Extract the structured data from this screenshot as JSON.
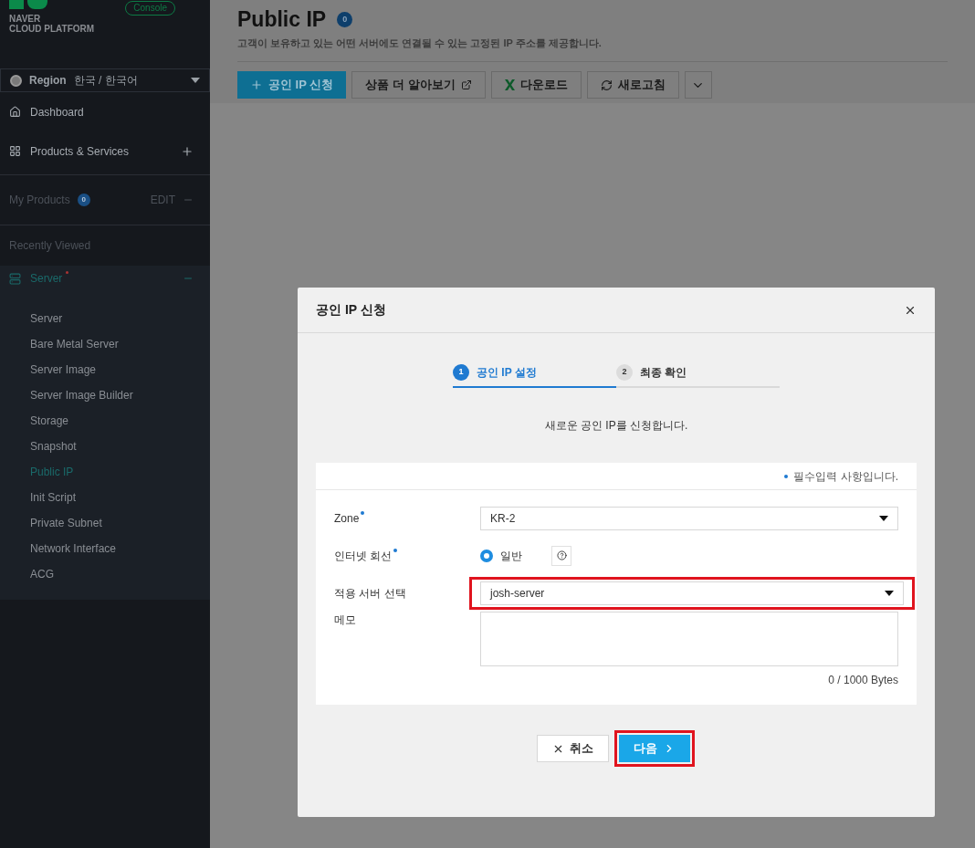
{
  "sidebar": {
    "logo": {
      "line1": "NAVER",
      "line2": "CLOUD PLATFORM"
    },
    "console_badge": "Console",
    "region": {
      "label": "Region",
      "value": "한국 / 한국어"
    },
    "nav": [
      {
        "kind": "dashboard",
        "label": "Dashboard"
      },
      {
        "kind": "products",
        "label": "Products & Services"
      }
    ],
    "my_products": {
      "label": "My Products",
      "count": "0",
      "edit": "EDIT"
    },
    "recently_viewed": "Recently Viewed",
    "section": {
      "label": "Server",
      "expanded": true,
      "items": [
        {
          "label": "Server",
          "selected": false
        },
        {
          "label": "Bare Metal Server",
          "selected": false
        },
        {
          "label": "Server Image",
          "selected": false
        },
        {
          "label": "Server Image Builder",
          "selected": false
        },
        {
          "label": "Storage",
          "selected": false
        },
        {
          "label": "Snapshot",
          "selected": false
        },
        {
          "label": "Public IP",
          "selected": true
        },
        {
          "label": "Init Script",
          "selected": false
        },
        {
          "label": "Private Subnet",
          "selected": false
        },
        {
          "label": "Network Interface",
          "selected": false
        },
        {
          "label": "ACG",
          "selected": false
        }
      ]
    }
  },
  "page": {
    "title": "Public IP",
    "count": "0",
    "description": "고객이 보유하고 있는 어떤 서버에도 연결될 수 있는 고정된 IP 주소를 제공합니다.",
    "toolbar": [
      {
        "kind": "primary",
        "label": "공인 IP 신청"
      },
      {
        "kind": "external",
        "label": "상품 더 알아보기"
      },
      {
        "kind": "excel",
        "label": "다운로드"
      },
      {
        "kind": "refresh",
        "label": "새로고침"
      },
      {
        "kind": "more"
      }
    ]
  },
  "modal": {
    "title": "공인 IP 신청",
    "steps": [
      {
        "number": "1",
        "label": "공인 IP 설정",
        "selected": true
      },
      {
        "number": "2",
        "label": "최종 확인",
        "selected": false
      }
    ],
    "intro": "새로운 공인 IP를 신청합니다.",
    "required_note": "필수입력 사항입니다.",
    "fields": [
      {
        "kind": "select",
        "label": "Zone",
        "required": true,
        "value": "KR-2",
        "highlighted": false
      },
      {
        "kind": "radio",
        "label": "인터넷 회선",
        "required": true,
        "option": "일반",
        "checked": true
      },
      {
        "kind": "select",
        "label": "적용 서버 선택",
        "required": false,
        "value": "josh-server",
        "highlighted": true
      },
      {
        "kind": "textarea",
        "label": "메모",
        "required": false,
        "counter": "0 / 1000 Bytes"
      }
    ],
    "buttons": [
      {
        "kind": "cancel",
        "label": "취소",
        "highlighted": false
      },
      {
        "kind": "next",
        "label": "다음",
        "highlighted": true
      }
    ]
  }
}
